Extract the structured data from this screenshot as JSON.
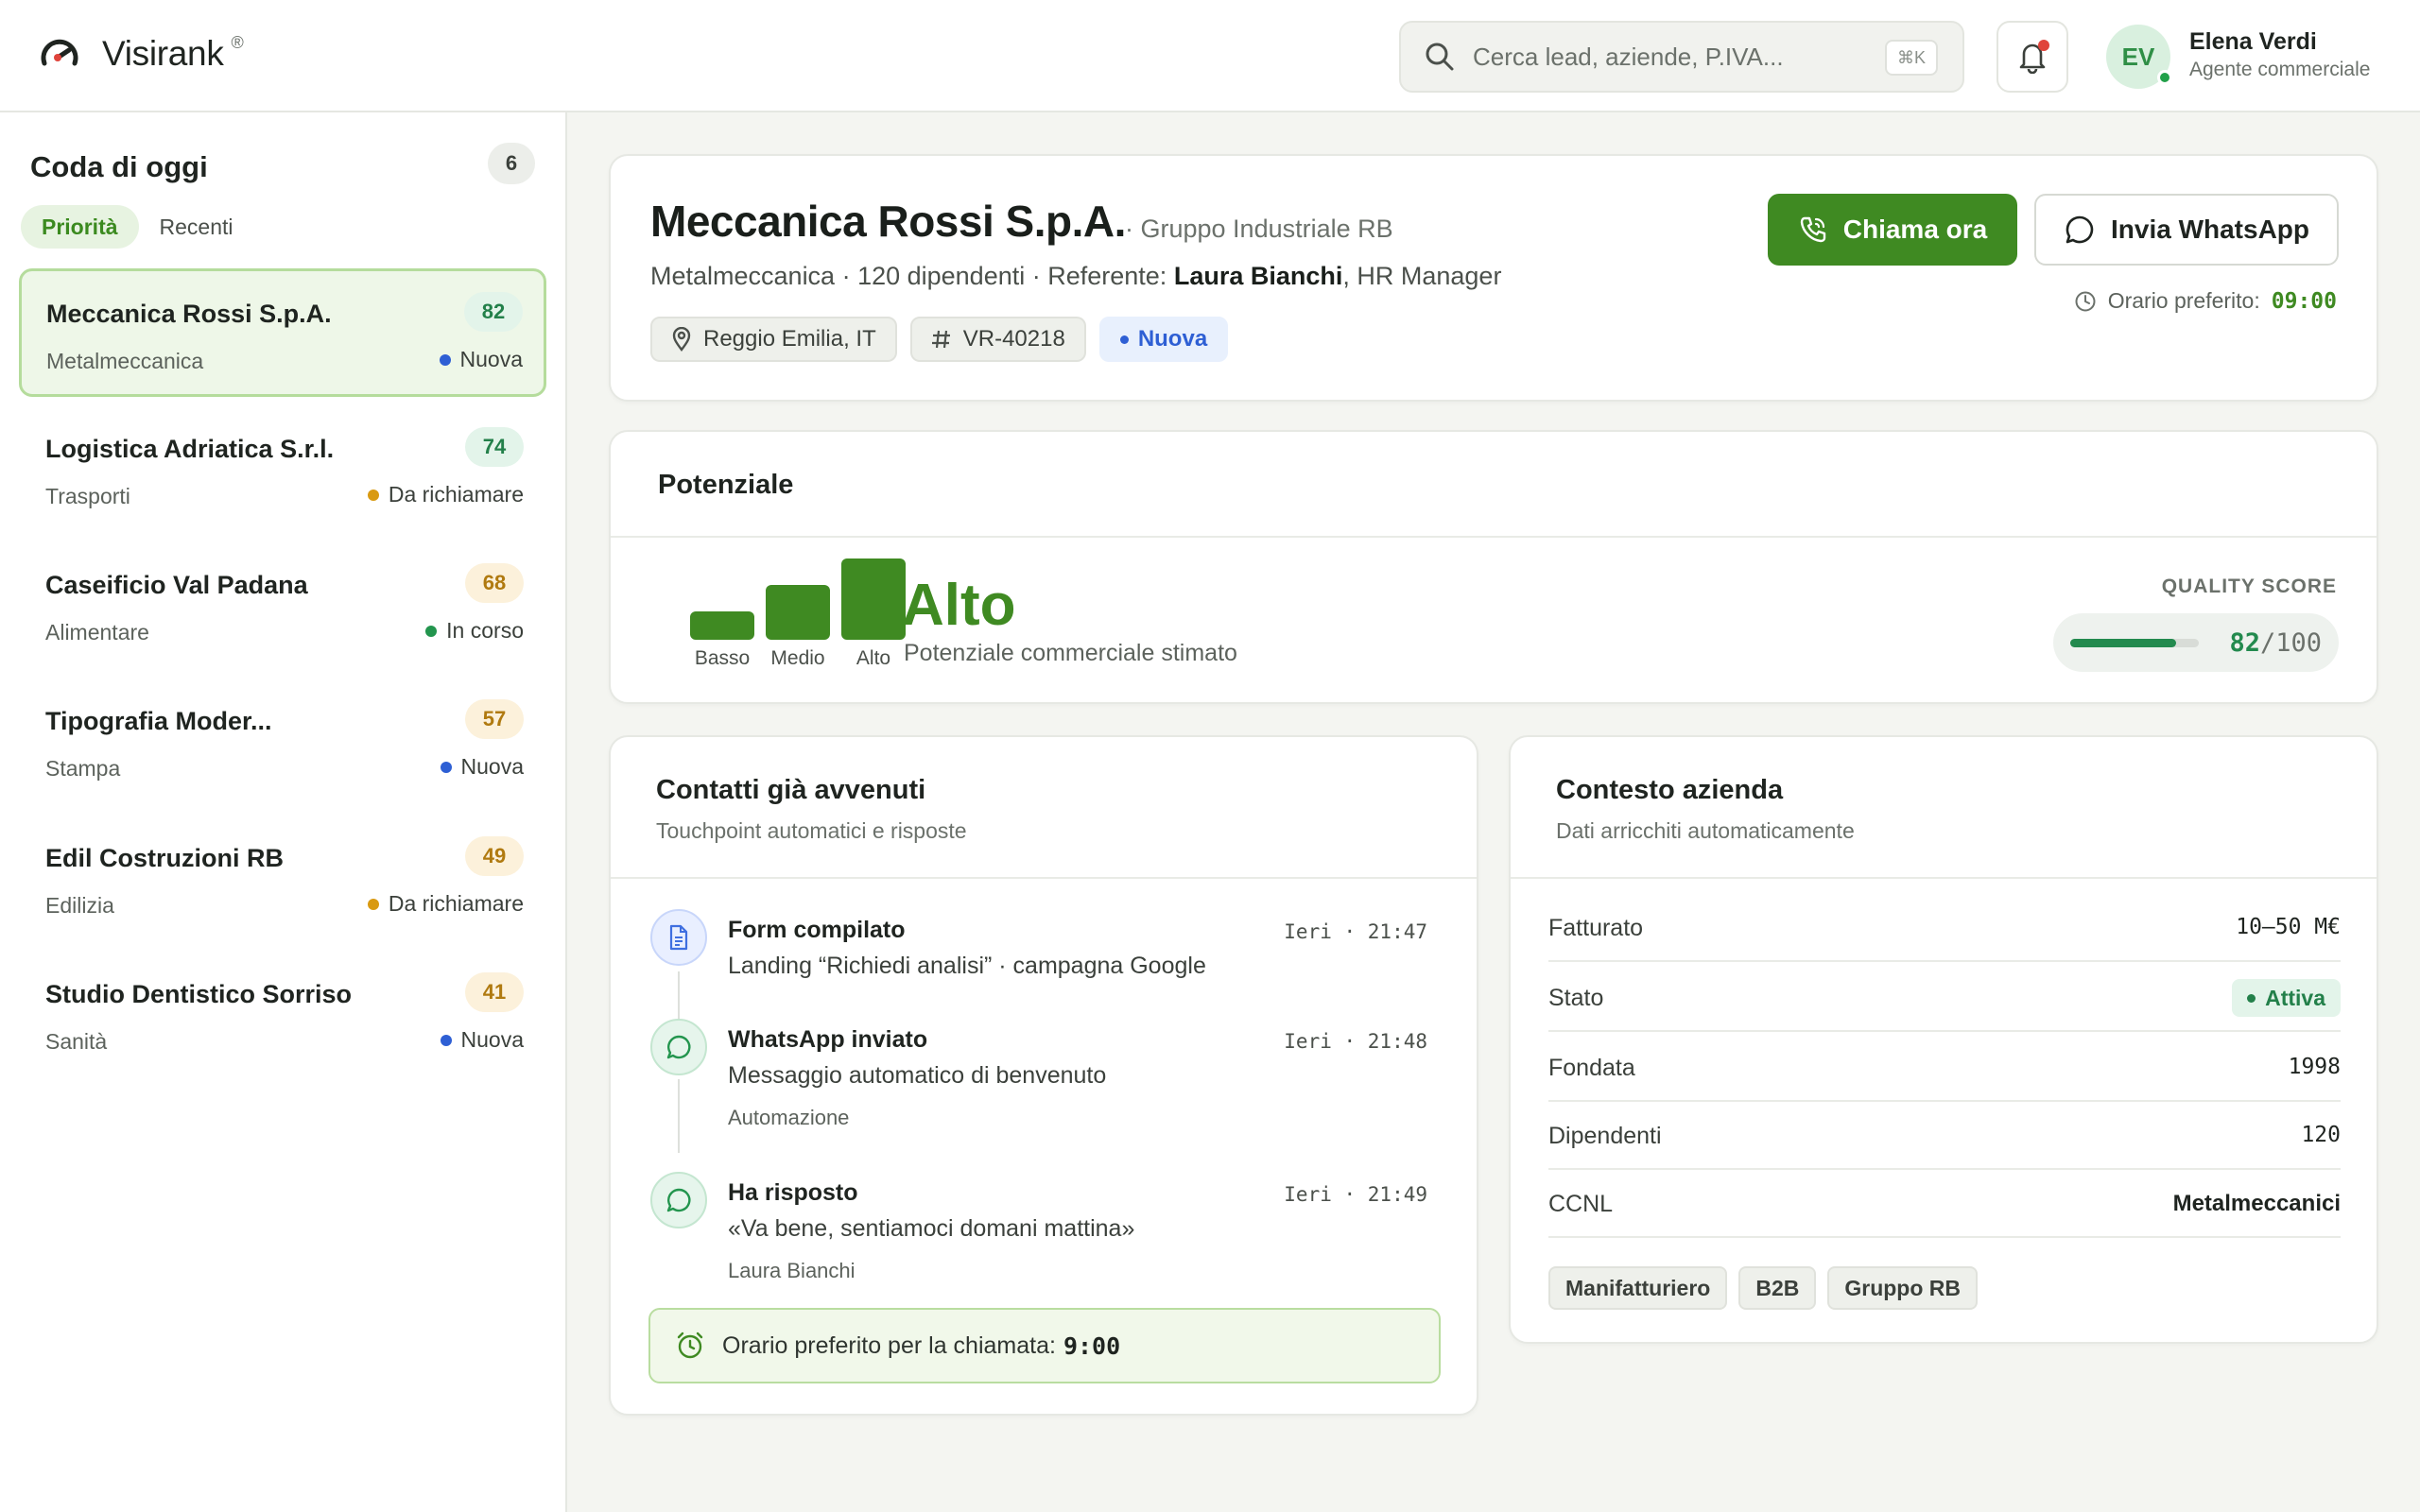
{
  "app": {
    "name": "Visirank",
    "reg": "®"
  },
  "search": {
    "placeholder": "Cerca lead, aziende, P.IVA...",
    "shortcut": "⌘K"
  },
  "user": {
    "initials": "EV",
    "name": "Elena Verdi",
    "role": "Agente commerciale"
  },
  "sidebar": {
    "title": "Coda di oggi",
    "count": "6",
    "tabs": [
      {
        "label": "Priorità",
        "active": true
      },
      {
        "label": "Recenti",
        "active": false
      }
    ],
    "leads": [
      {
        "name": "Meccanica Rossi S.p.A.",
        "sector": "Metalmeccanica",
        "score": "82",
        "status": "Nuova",
        "status_color": "#2e5fd4",
        "score_style": "green",
        "active": true
      },
      {
        "name": "Logistica Adriatica S.r.l.",
        "sector": "Trasporti",
        "score": "74",
        "status": "Da richiamare",
        "status_color": "#d99a12",
        "score_style": "green",
        "active": false
      },
      {
        "name": "Caseificio Val Padana",
        "sector": "Alimentare",
        "score": "68",
        "status": "In corso",
        "status_color": "#23954e",
        "score_style": "amber",
        "active": false
      },
      {
        "name": "Tipografia Moder...",
        "sector": "Stampa",
        "score": "57",
        "status": "Nuova",
        "status_color": "#2e5fd4",
        "score_style": "amber",
        "active": false
      },
      {
        "name": "Edil Costruzioni RB",
        "sector": "Edilizia",
        "score": "49",
        "status": "Da richiamare",
        "status_color": "#d99a12",
        "score_style": "amber",
        "active": false
      },
      {
        "name": "Studio Dentistico Sorriso",
        "sector": "Sanità",
        "score": "41",
        "status": "Nuova",
        "status_color": "#2e5fd4",
        "score_style": "amber",
        "active": false
      }
    ]
  },
  "lead": {
    "name": "Meccanica Rossi S.p.A.",
    "group": "· Gruppo Industriale RB",
    "meta_prefix": "Metalmeccanica · 120 dipendenti · Referente:",
    "contact_name": "Laura Bianchi",
    "contact_role": ", HR Manager",
    "location": "Reggio Emilia, IT",
    "code": "VR-40218",
    "status": "Nuova",
    "call_label": "Chiama ora",
    "whatsapp_label": "Invia WhatsApp",
    "preferred_label": "Orario preferito:",
    "preferred_time": "09:00"
  },
  "potential": {
    "title": "Potenziale",
    "levels": [
      "Basso",
      "Medio",
      "Alto"
    ],
    "level_values": [
      1,
      2,
      3
    ],
    "current": "Alto",
    "description": "Potenziale commerciale stimato",
    "quality_label": "QUALITY SCORE",
    "quality_score": "82",
    "quality_max": "/100",
    "quality_fraction": 0.82
  },
  "contacts": {
    "title": "Contatti già avvenuti",
    "subtitle": "Touchpoint automatici e risposte",
    "events": [
      {
        "title": "Form compilato",
        "time": "Ieri · 21:47",
        "desc": "Landing “Richiedi analisi” · campagna Google",
        "meta": "",
        "icon": "document-icon"
      },
      {
        "title": "WhatsApp inviato",
        "time": "Ieri · 21:48",
        "desc": "Messaggio automatico di benvenuto",
        "meta": "Automazione",
        "icon": "chat-icon"
      },
      {
        "title": "Ha risposto",
        "time": "Ieri · 21:49",
        "desc": "«Va bene, sentiamoci domani mattina»",
        "meta": "Laura Bianchi",
        "icon": "chat-icon"
      }
    ],
    "preferred_text": "Orario preferito per la chiamata:",
    "preferred_time": "9:00"
  },
  "context": {
    "title": "Contesto azienda",
    "subtitle": "Dati arricchiti automaticamente",
    "revenue_label": "Fatturato",
    "revenue": "10–50 M€",
    "state_label": "Stato",
    "state": "Attiva",
    "founded_label": "Fondata",
    "founded": "1998",
    "employees_label": "Dipendenti",
    "employees": "120",
    "ccnl_label": "CCNL",
    "ccnl": "Metalmeccanici",
    "tags": [
      "Manifatturiero",
      "B2B",
      "Gruppo RB"
    ]
  },
  "colors": {
    "accent": "#3f8a22",
    "score_green": "#238a4e",
    "blue": "#2e5fd4",
    "amber": "#d99a12"
  }
}
